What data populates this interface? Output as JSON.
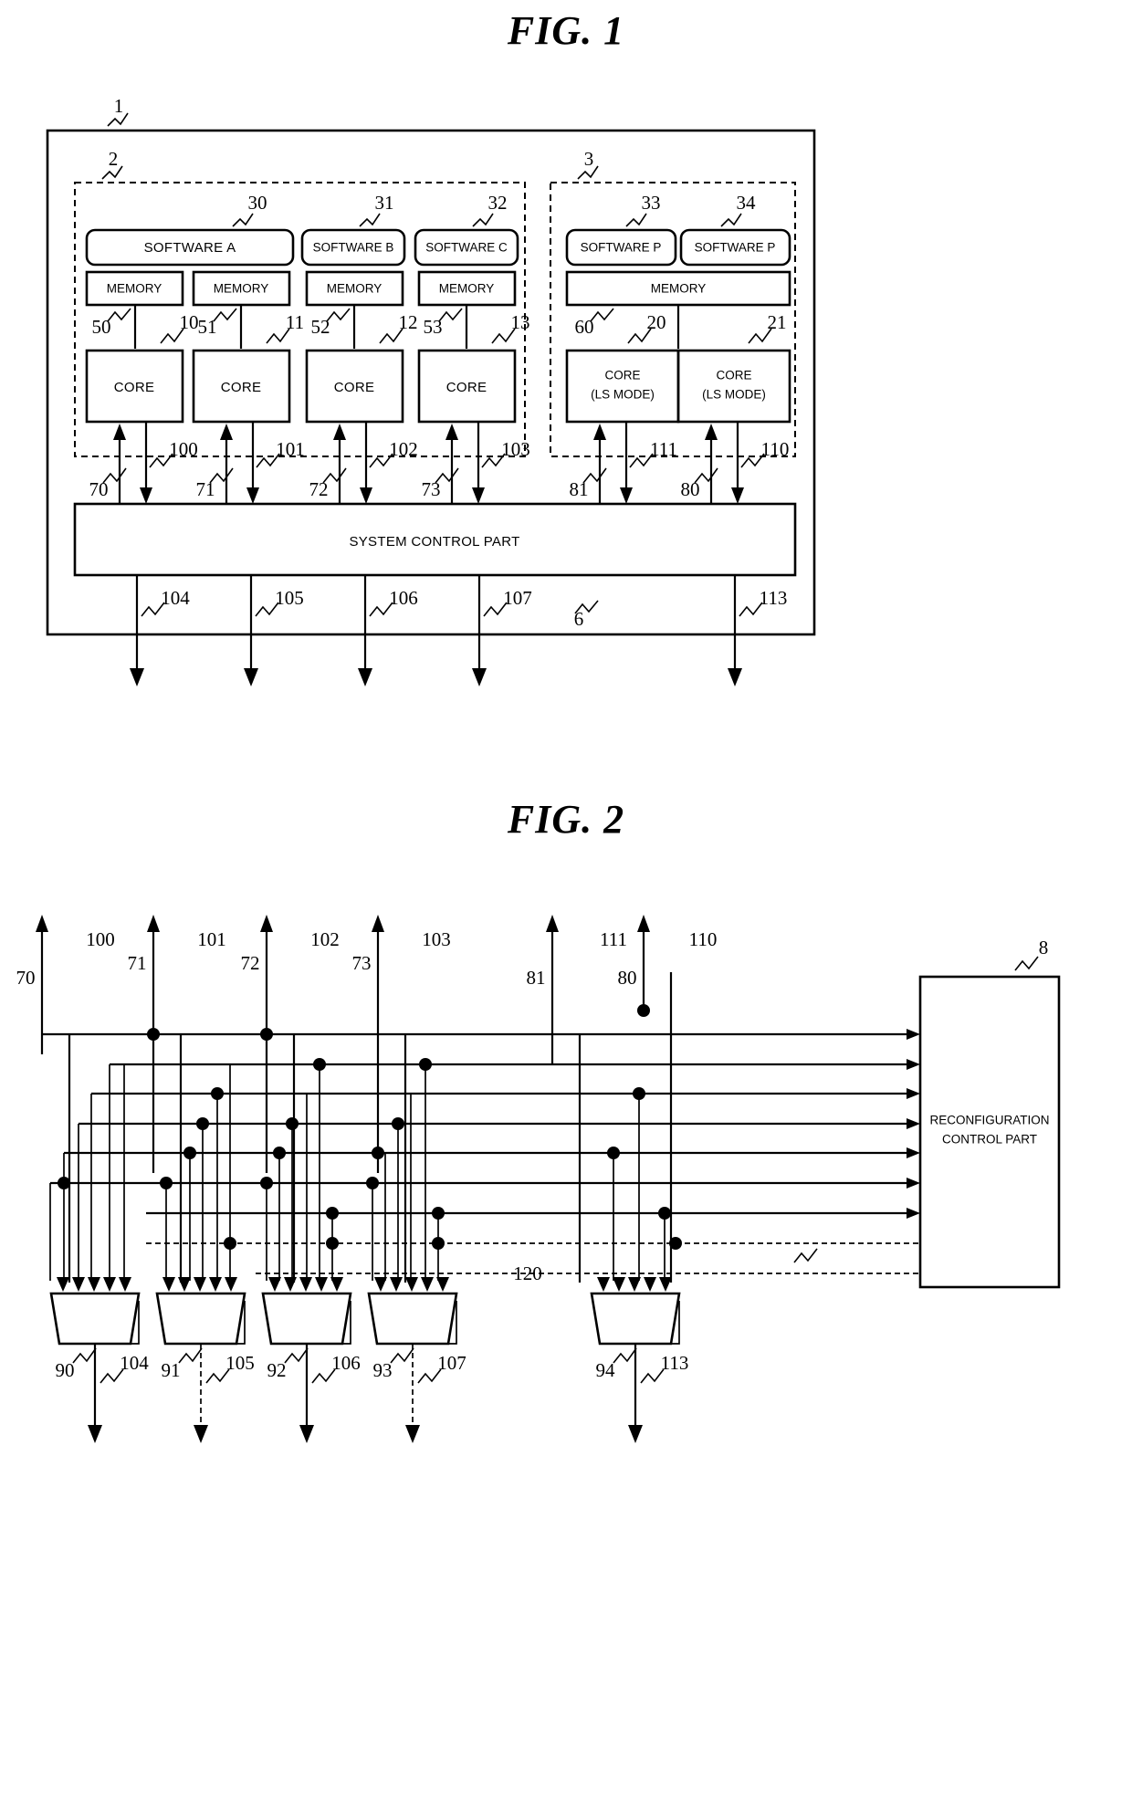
{
  "figures": [
    {
      "id": "fig1",
      "title": "FIG. 1",
      "outer_ref": "1",
      "groups": [
        {
          "ref": "2",
          "label": "group-normal-cores"
        },
        {
          "ref": "3",
          "label": "group-ls-mode-cores"
        }
      ],
      "software_blocks": [
        {
          "ref": "30",
          "label": "SOFTWARE A"
        },
        {
          "ref": "31",
          "label": "SOFTWARE B"
        },
        {
          "ref": "32",
          "label": "SOFTWARE C"
        },
        {
          "ref": "33",
          "label": "SOFTWARE P"
        },
        {
          "ref": "34",
          "label": "SOFTWARE P"
        }
      ],
      "memory_blocks": [
        {
          "ref": "50",
          "label": "MEMORY"
        },
        {
          "ref": "51",
          "label": "MEMORY"
        },
        {
          "ref": "52",
          "label": "MEMORY"
        },
        {
          "ref": "53",
          "label": "MEMORY"
        },
        {
          "ref": "60",
          "label": "MEMORY"
        }
      ],
      "core_blocks": [
        {
          "ref": "10",
          "label": "CORE",
          "sub": ""
        },
        {
          "ref": "11",
          "label": "CORE",
          "sub": ""
        },
        {
          "ref": "12",
          "label": "CORE",
          "sub": ""
        },
        {
          "ref": "13",
          "label": "CORE",
          "sub": ""
        },
        {
          "ref": "20",
          "label": "CORE",
          "sub": "(LS MODE)"
        },
        {
          "ref": "21",
          "label": "CORE",
          "sub": "(LS MODE)"
        }
      ],
      "system_control": {
        "ref": "6",
        "label": "SYSTEM CONTROL PART"
      },
      "signal_up_refs": [
        "70",
        "71",
        "72",
        "73",
        "81",
        "80"
      ],
      "signal_down_refs": [
        "100",
        "101",
        "102",
        "103",
        "111",
        "110"
      ],
      "output_refs": [
        "104",
        "105",
        "106",
        "107",
        "113"
      ]
    },
    {
      "id": "fig2",
      "title": "FIG. 2",
      "reconfig": {
        "ref": "8",
        "line1": "RECONFIGURATION",
        "line2": "CONTROL PART"
      },
      "top_up_refs": [
        "70",
        "71",
        "72",
        "73",
        "81",
        "80"
      ],
      "top_down_refs": [
        "100",
        "101",
        "102",
        "103",
        "111",
        "110"
      ],
      "mux_refs": [
        "90",
        "91",
        "92",
        "93",
        "94"
      ],
      "output_refs": [
        "104",
        "105",
        "106",
        "107",
        "113"
      ],
      "select_bus_ref": "120"
    }
  ]
}
